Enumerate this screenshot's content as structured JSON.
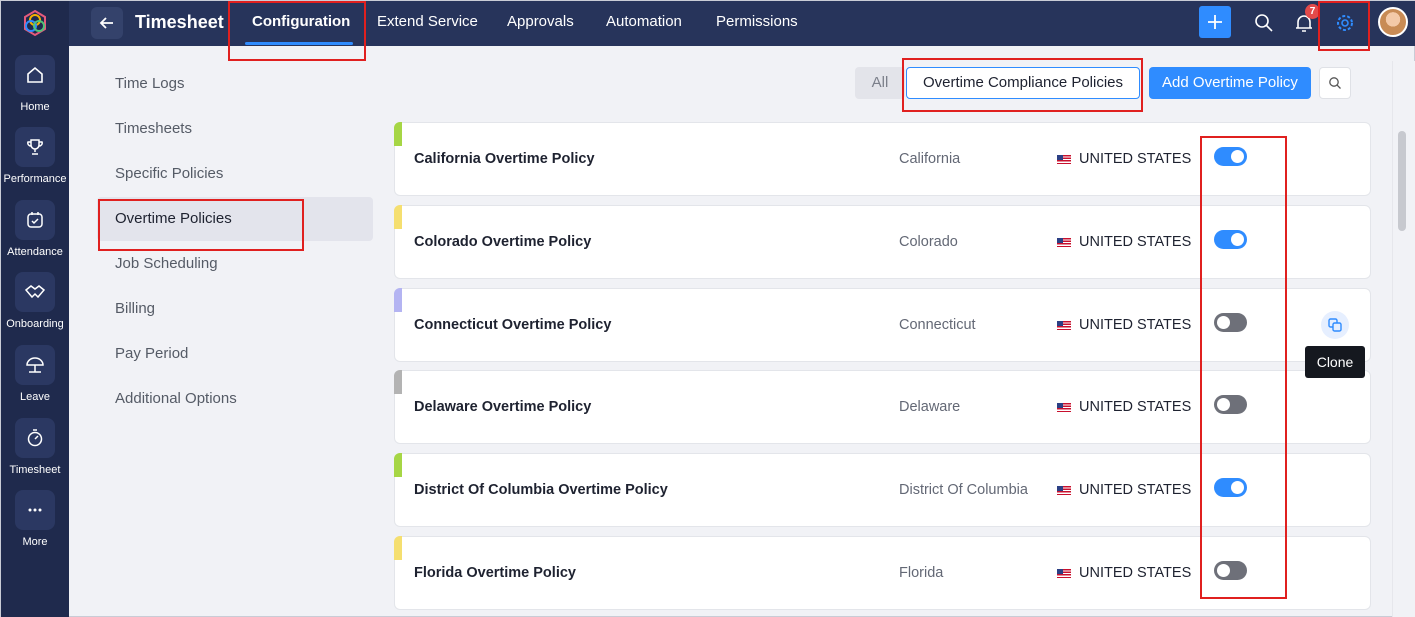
{
  "rail": {
    "items": [
      {
        "label": "Home",
        "icon": "home-icon"
      },
      {
        "label": "Performance",
        "icon": "trophy-icon"
      },
      {
        "label": "Attendance",
        "icon": "calendar-icon"
      },
      {
        "label": "Onboarding",
        "icon": "handshake-icon"
      },
      {
        "label": "Leave",
        "icon": "umbrella-icon"
      },
      {
        "label": "Timesheet",
        "icon": "stopwatch-icon"
      },
      {
        "label": "More",
        "icon": "more-icon"
      }
    ]
  },
  "topbar": {
    "title": "Timesheet",
    "tabs": [
      {
        "label": "Configuration",
        "active": true
      },
      {
        "label": "Extend Service"
      },
      {
        "label": "Approvals"
      },
      {
        "label": "Automation"
      },
      {
        "label": "Permissions"
      }
    ],
    "notification_count": "7"
  },
  "menu": {
    "items": [
      {
        "label": "Time Logs"
      },
      {
        "label": "Timesheets"
      },
      {
        "label": "Specific Policies"
      },
      {
        "label": "Overtime Policies",
        "selected": true
      },
      {
        "label": "Job Scheduling"
      },
      {
        "label": "Billing"
      },
      {
        "label": "Pay Period"
      },
      {
        "label": "Additional Options"
      }
    ]
  },
  "filters": {
    "all_label": "All",
    "selected_label": "Overtime Compliance Policies",
    "add_label": "Add Overtime Policy"
  },
  "policies": [
    {
      "name": "California Overtime Policy",
      "state": "California",
      "country": "UNITED STATES",
      "enabled": true,
      "accent": "#a6d645"
    },
    {
      "name": "Colorado Overtime Policy",
      "state": "Colorado",
      "country": "UNITED STATES",
      "enabled": true,
      "accent": "#f5df70"
    },
    {
      "name": "Connecticut Overtime Policy",
      "state": "Connecticut",
      "country": "UNITED STATES",
      "enabled": false,
      "accent": "#b4b4f2"
    },
    {
      "name": "Delaware Overtime Policy",
      "state": "Delaware",
      "country": "UNITED STATES",
      "enabled": false,
      "accent": "#b3b3b3"
    },
    {
      "name": "District Of Columbia Overtime Policy",
      "state": "District Of Columbia",
      "country": "UNITED STATES",
      "enabled": true,
      "accent": "#a6d645"
    },
    {
      "name": "Florida Overtime Policy",
      "state": "Florida",
      "country": "UNITED STATES",
      "enabled": false,
      "accent": "#f5df70"
    }
  ],
  "tooltip": {
    "label": "Clone"
  },
  "colors": {
    "accent": "#2f8cff",
    "nav": "#27345b",
    "rail": "#1f2a4d",
    "annotation": "#e0201f"
  }
}
